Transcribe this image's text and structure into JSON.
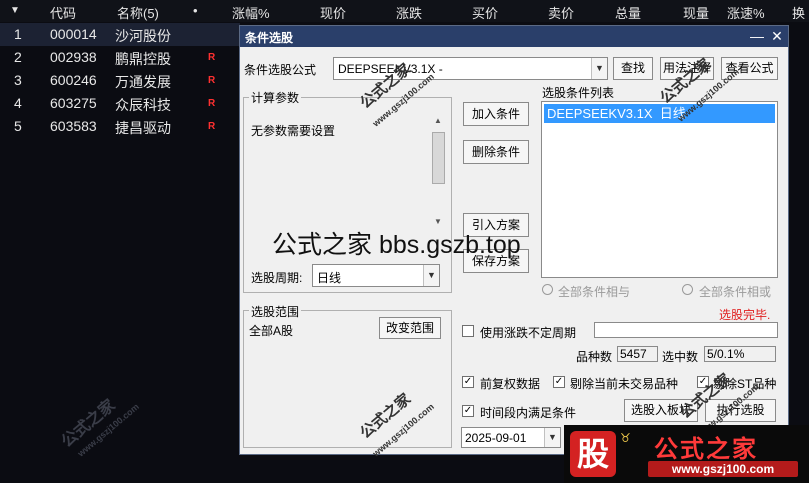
{
  "table": {
    "headers": {
      "arrow": "▼",
      "code": "代码",
      "name": "名称(5)",
      "dot": "•",
      "change_pct": "涨幅%",
      "price": "现价",
      "change": "涨跌",
      "bid": "买价",
      "ask": "卖价",
      "volume": "总量",
      "cur_volume": "现量",
      "speed": "涨速%",
      "turnover": "换"
    },
    "rows": [
      {
        "idx": "1",
        "code": "000014",
        "name": "沙河股份",
        "flag": ""
      },
      {
        "idx": "2",
        "code": "002938",
        "name": "鹏鼎控股",
        "flag": "R"
      },
      {
        "idx": "3",
        "code": "600246",
        "name": "万通发展",
        "flag": "R"
      },
      {
        "idx": "4",
        "code": "603275",
        "name": "众辰科技",
        "flag": "R"
      },
      {
        "idx": "5",
        "code": "603583",
        "name": "捷昌驱动",
        "flag": "R"
      }
    ]
  },
  "dialog": {
    "title": "条件选股",
    "minimize": "—",
    "close": "✕",
    "formula_label": "条件选股公式",
    "formula_value": "DEEPSEEKV3.1X -",
    "find_btn": "查找",
    "usage_btn": "用法注释",
    "view_btn": "查看公式",
    "params_group": "计算参数",
    "params_text": "无参数需要设置",
    "period_label": "选股周期:",
    "period_value": "日线",
    "add_btn": "加入条件",
    "del_btn": "删除条件",
    "import_btn": "引入方案",
    "save_btn": "保存方案",
    "conditions_label": "选股条件列表",
    "conditions": [
      "DEEPSEEKV3.1X  日线"
    ],
    "radio_and": "全部条件相与",
    "radio_or": "全部条件相或",
    "status": "选股完毕.",
    "range_group": "选股范围",
    "range_value": "全部A股",
    "change_range_btn": "改变范围",
    "use_period_label": "使用涨跌不定周期",
    "count_label": "品种数",
    "count_value": "5457",
    "selected_label": "选中数",
    "selected_value": "5/0.1%",
    "opt_rights": "前复权数据",
    "opt_remove_untraded": "剔除当前未交易品种",
    "opt_remove_st": "剔除ST品种",
    "opt_time_range": "时间段内满足条件",
    "date_value": "2025-09-01",
    "to_board_btn": "选股入板块",
    "run_btn": "执行选股",
    "check_mark": "✓"
  },
  "watermarks": {
    "overlay": "公式之家 bbs.gszb.top",
    "stamp": "公式之家",
    "stamp_url": "www.gszj100.com",
    "logo_char": "股",
    "logo_title": "公式之家",
    "logo_url": "www.gszj100.com"
  },
  "colors": {
    "accent": "#2a3f6a",
    "selection": "#3399ff",
    "status_red": "#e02020",
    "flag_red": "#ff3030"
  }
}
